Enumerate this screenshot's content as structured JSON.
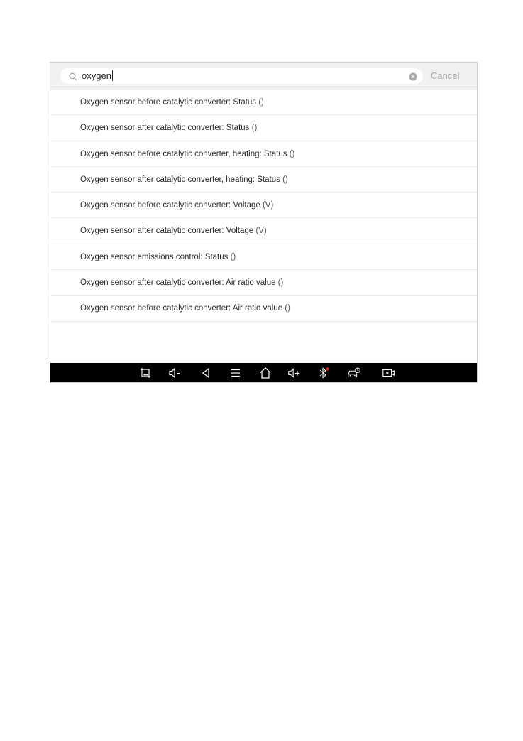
{
  "search": {
    "query": "oxygen",
    "cancel_label": "Cancel"
  },
  "results": [
    {
      "label": "Oxygen sensor before catalytic converter: Status",
      "unit": " ()"
    },
    {
      "label": "Oxygen sensor after catalytic converter: Status",
      "unit": " ()"
    },
    {
      "label": "Oxygen sensor before catalytic converter, heating: Status",
      "unit": " ()"
    },
    {
      "label": "Oxygen sensor after catalytic converter, heating: Status",
      "unit": " ()"
    },
    {
      "label": "Oxygen sensor before catalytic converter: Voltage",
      "unit": " (V)"
    },
    {
      "label": "Oxygen sensor after catalytic converter: Voltage",
      "unit": " (V)"
    },
    {
      "label": "Oxygen sensor emissions control: Status",
      "unit": " ()"
    },
    {
      "label": "Oxygen sensor after catalytic converter: Air ratio value",
      "unit": " ()"
    },
    {
      "label": "Oxygen sensor before catalytic converter: Air ratio value",
      "unit": " ()"
    }
  ],
  "nav_bar": {
    "icons": [
      "screenshot-icon",
      "volume-down-icon",
      "back-icon",
      "menu-icon",
      "home-icon",
      "volume-up-icon",
      "bluetooth-icon",
      "vehicle-diagnostic-icon",
      "screen-record-icon"
    ]
  },
  "colors": {
    "nav_background": "#000000",
    "bluetooth_indicator": "#e02020",
    "cancel_text": "#a8a8a8"
  }
}
